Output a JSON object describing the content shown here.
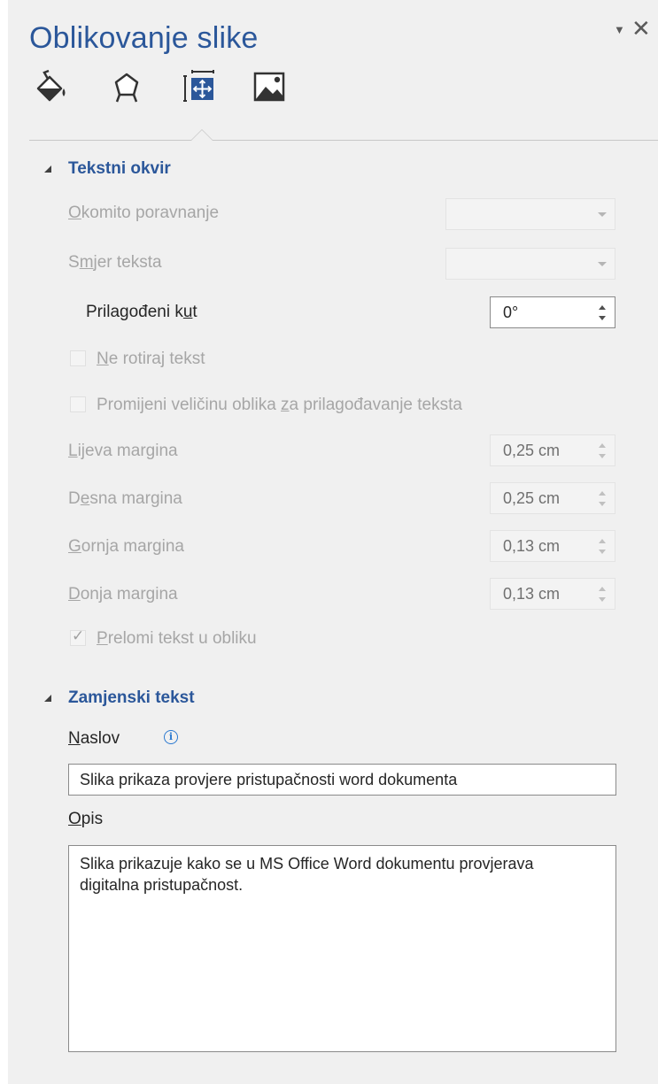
{
  "pane": {
    "title": "Oblikovanje slike",
    "menu_icon": "chevron-down-icon",
    "close_glyph": "✕",
    "tabs": [
      "fill-and-line-icon",
      "effects-icon",
      "size-and-properties-icon",
      "picture-icon"
    ]
  },
  "text_box": {
    "header": "Tekstni okvir",
    "vertical_alignment": {
      "label_key": "O",
      "label_rest": "komito poravnanje",
      "value": ""
    },
    "text_direction": {
      "label_pre": "S",
      "label_key": "m",
      "label_rest": "jer teksta",
      "value": ""
    },
    "custom_angle": {
      "label_pre": "Prilagođeni k",
      "label_key": "u",
      "label_rest": "t",
      "value": "0°"
    },
    "do_not_rotate": {
      "label_key": "N",
      "label_rest": "e rotiraj tekst",
      "checked": false
    },
    "resize_shape": {
      "label_pre": "Promijeni veličinu oblika ",
      "label_key": "z",
      "label_rest": "a prilagođavanje teksta",
      "checked": false
    },
    "left_margin": {
      "label_key": "L",
      "label_rest": "ijeva margina",
      "value": "0,25 cm"
    },
    "right_margin": {
      "label_pre": "D",
      "label_key": "e",
      "label_rest": "sna margina",
      "value": "0,25 cm"
    },
    "top_margin": {
      "label_key": "G",
      "label_rest": "ornja margina",
      "value": "0,13 cm"
    },
    "bottom_margin": {
      "label_key": "D",
      "label_rest": "onja margina",
      "value": "0,13 cm"
    },
    "wrap_text": {
      "label_key": "P",
      "label_rest": "relomi tekst u obliku",
      "checked": true
    }
  },
  "alt_text": {
    "header": "Zamjenski tekst",
    "title_label_key": "N",
    "title_label_rest": "aslov",
    "info_icon": "info-icon",
    "title_value": "Slika prikaza provjere pristupačnosti word dokumenta",
    "description_label_key": "O",
    "description_label_rest": "pis",
    "description_value": "Slika prikazuje kako se u MS Office Word dokumentu provjerava digitalna pristupačnost."
  },
  "colors": {
    "accent": "#2b579a",
    "pane_background": "#f0f0f0",
    "disabled_text": "#a6a6a6"
  }
}
